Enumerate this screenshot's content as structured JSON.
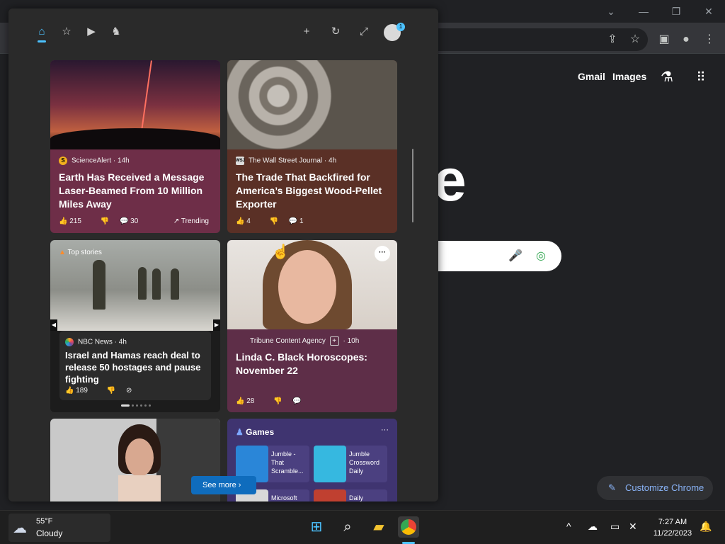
{
  "browser": {
    "ntp_links": {
      "gmail": "Gmail",
      "images": "Images"
    },
    "logo_fragment": "e",
    "customize_label": "Customize Chrome"
  },
  "widgets": {
    "header": {
      "tab_home": "home-icon",
      "tab_favorites": "star-plus-icon",
      "tab_video": "video-icon",
      "tab_sports": "chess-icon",
      "add": "+",
      "refresh": "↻",
      "expand": "⤢",
      "notification_count": "1"
    },
    "cards": [
      {
        "source": "ScienceAlert",
        "source_logo": "S",
        "age": "14h",
        "headline": "Earth Has Received a Message Laser-Beamed From 10 Million Miles Away",
        "likes": "215",
        "comments": "30",
        "badge": "Trending"
      },
      {
        "source": "The Wall Street Journal",
        "source_logo": "WSJ",
        "age": "4h",
        "headline": "The Trade That Backfired for America’s Biggest Wood-Pellet Exporter",
        "likes": "4",
        "comments": "1"
      },
      {
        "tag": "Top stories",
        "source": "NBC News",
        "age": "4h",
        "headline": "Israel and Hamas reach deal to release 50 hostages and pause fighting",
        "likes": "189"
      },
      {
        "source": "Tribune Content Agency",
        "age": "10h",
        "headline": "Linda C. Black Horoscopes: November 22",
        "likes": "28",
        "more": "···"
      }
    ],
    "games": {
      "title": "Games",
      "more": "···",
      "items": [
        {
          "label": "Jumble - That Scramble..."
        },
        {
          "label": "Jumble Crossword Daily"
        },
        {
          "label": "Microsoft"
        },
        {
          "label": "Daily"
        }
      ]
    },
    "see_more": "See more"
  },
  "taskbar": {
    "weather_temp": "55°F",
    "weather_desc": "Cloudy",
    "time": "7:27 AM",
    "date": "11/22/2023"
  }
}
